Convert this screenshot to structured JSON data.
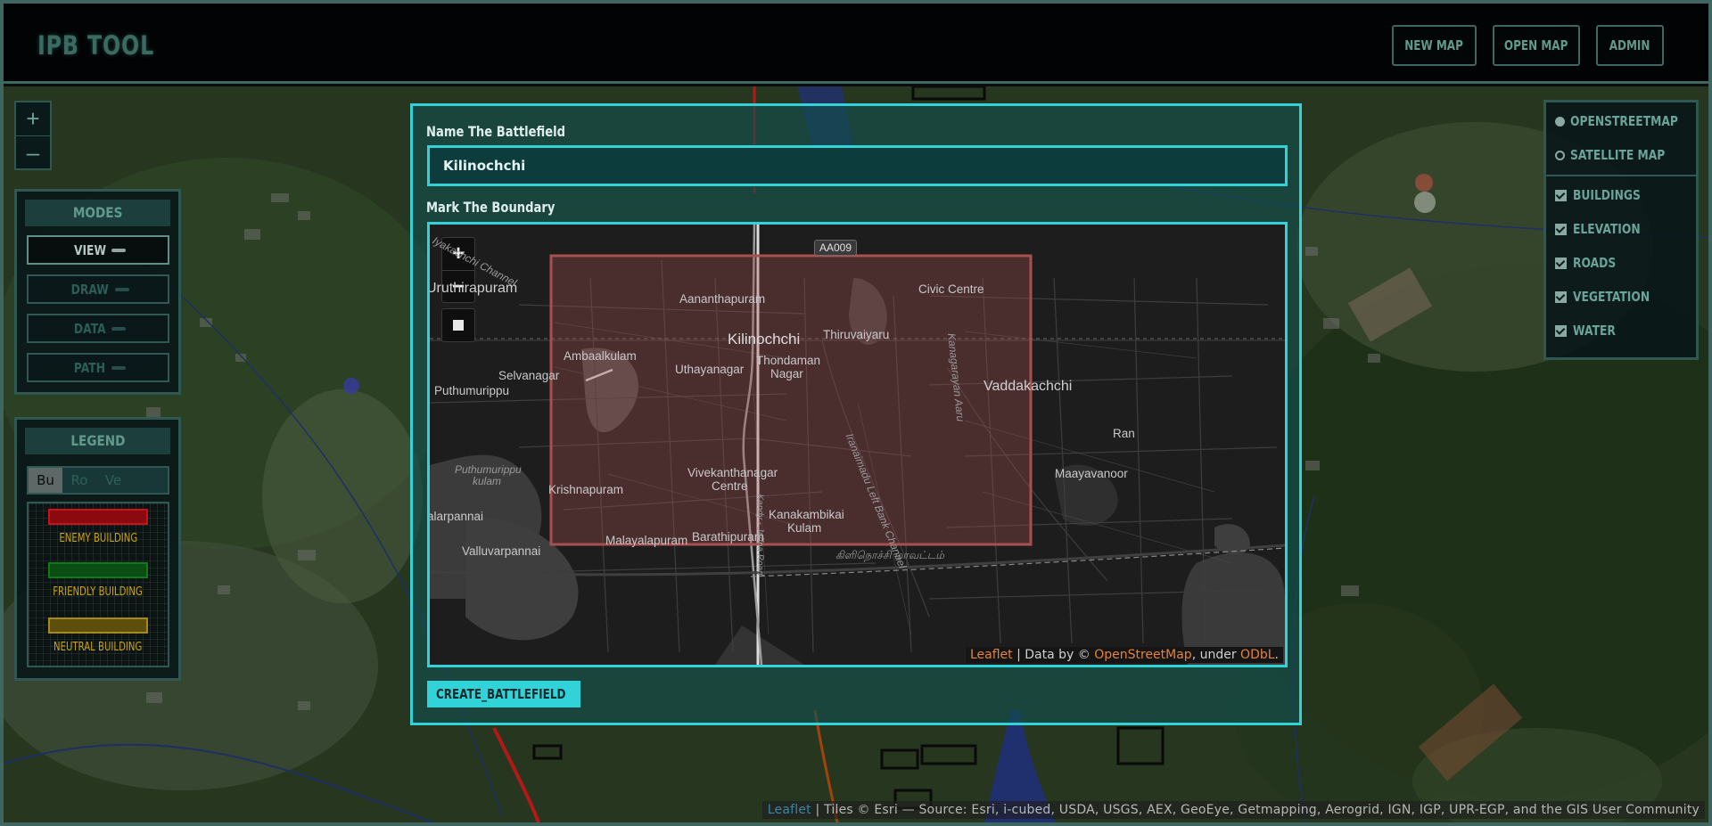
{
  "header": {
    "title": "IPB TOOL",
    "buttons": {
      "new_map": "NEW MAP",
      "open_map": "OPEN MAP",
      "admin": "ADMIN"
    }
  },
  "main_map": {
    "zoom_in": "+",
    "zoom_out": "–",
    "attribution_link": "Leaflet",
    "attribution_text": " | Tiles © Esri — Source: Esri, i-cubed, USDA, USGS, AEX, GeoEye, Getmapping, Aerogrid, IGN, IGP, UPR-EGP, and the GIS User Community"
  },
  "modes": {
    "title": "MODES",
    "items": [
      {
        "label": "VIEW",
        "active": true
      },
      {
        "label": "DRAW",
        "active": false
      },
      {
        "label": "DATA",
        "active": false
      },
      {
        "label": "PATH",
        "active": false
      }
    ]
  },
  "legend": {
    "title": "LEGEND",
    "tabs": [
      {
        "label": "Bu",
        "active": true
      },
      {
        "label": "Ro",
        "active": false
      },
      {
        "label": "Ve",
        "active": false
      }
    ],
    "items": [
      {
        "label": "ENEMY BUILDING",
        "color": "#c8111b"
      },
      {
        "label": "FRIENDLY BUILDING",
        "color": "#0f7a1a"
      },
      {
        "label": "NEUTRAL BUILDING",
        "color": "#a78a12"
      }
    ]
  },
  "layers": {
    "base_layers": [
      {
        "label": "OPENSTREETMAP",
        "selected": true
      },
      {
        "label": "SATELLITE MAP",
        "selected": false
      }
    ],
    "overlays": [
      {
        "label": "BUILDINGS",
        "checked": true
      },
      {
        "label": "ELEVATION",
        "checked": true
      },
      {
        "label": "ROADS",
        "checked": true
      },
      {
        "label": "VEGETATION",
        "checked": true
      },
      {
        "label": "WATER",
        "checked": true
      }
    ]
  },
  "dialog": {
    "name_label": "Name The Battlefield",
    "name_value": "Kilinochchi",
    "boundary_label": "Mark The Boundary",
    "create_button": "CREATE_BATTLEFIELD",
    "mini_map": {
      "zoom_in": "+",
      "zoom_out": "−",
      "road_shield": "AA009",
      "place_labels": [
        "Uruthirapuram",
        "Aananthapuram",
        "Civic Centre",
        "Kilinochchi",
        "Thiruvaiyaru",
        "Ambaalkulam",
        "Thondaman",
        "Nagar",
        "Selvanagar",
        "Uthayanagar",
        "Puthumurippu",
        "Vaddakachchi",
        "Ran",
        "Puthumurippu",
        "kulam",
        "Vivekanthanagar",
        "Centre",
        "Krishnapuram",
        "Maayavanoor",
        "alarpannai",
        "Kanakambikai",
        "Kulam",
        "Valluvarpannai",
        "Malayalapuram",
        "Barathipuram",
        "கிளிநொச்சி மாவட்டம்",
        "Iranaimadu Left Bank Channel",
        "Kanagarayan Aaru",
        "Kandy - Jaffna Road",
        "Iyakachchi Channel"
      ],
      "attribution_link1": "Leaflet",
      "attribution_sep": " | Data by © ",
      "attribution_link2": "OpenStreetMap",
      "attribution_mid": ", under ",
      "attribution_link3": "ODbL",
      "attribution_end": ".",
      "boundary_color": "#a8504f"
    }
  },
  "colors": {
    "accent": "#31d3d8",
    "panel_border": "#2f5853",
    "text_teal": "#5f9a8d"
  }
}
